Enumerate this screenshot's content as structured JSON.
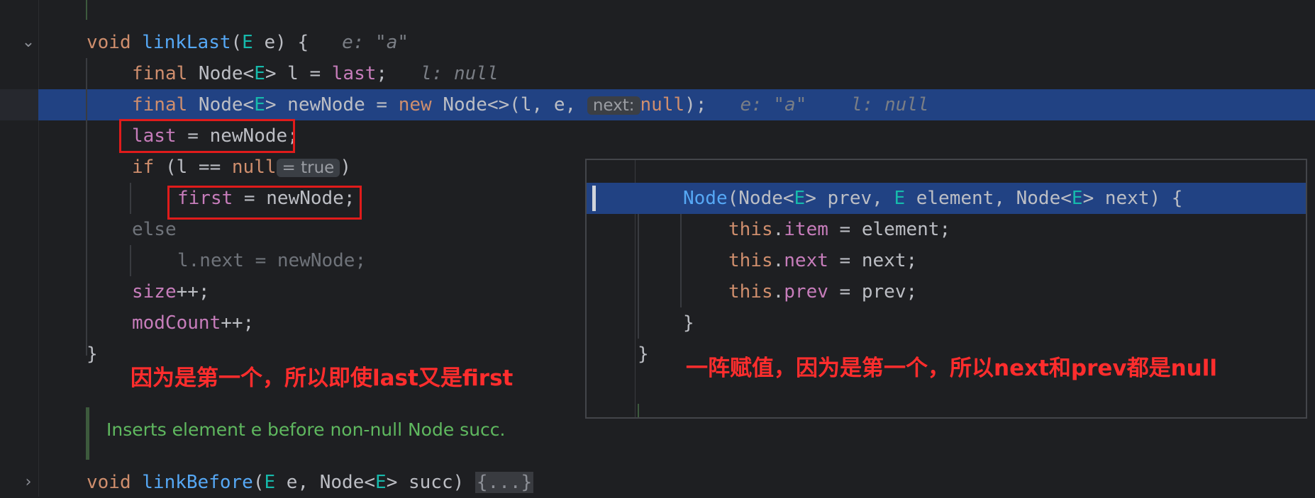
{
  "editor": {
    "line_0_partial": "",
    "link_last": {
      "kw_void": "void",
      "name": "linkLast",
      "open": "(",
      "type_E": "E",
      "param": " e) {",
      "hint": "e: \"a\""
    },
    "line_l": {
      "kw_final": "final",
      "type": " Node<",
      "type_E": "E",
      "rest1": "> l = ",
      "field_last": "last",
      "semi": ";",
      "hint": "l: null"
    },
    "line_newnode": {
      "kw_final": "final",
      "type": " Node<",
      "type_E": "E",
      "rest1": "> newNode = ",
      "kw_new": "new",
      "rest2": " Node<>(l, e, ",
      "inlay_next": "next:",
      "kw_null": "null",
      "rest3": ");",
      "hint_e": "e: \"a\"",
      "hint_l": "l: null"
    },
    "line_last_assign": {
      "field_last": "last",
      "rest": " = newNode;"
    },
    "line_if": {
      "kw_if": "if",
      "rest": " (l == ",
      "kw_null": "null",
      "inlay_true": "= true",
      "close": ")"
    },
    "line_first_assign": {
      "field_first": "first",
      "rest": " = newNode;"
    },
    "line_else": "else",
    "line_lnext": "l.next = newNode;",
    "line_size": {
      "field": "size",
      "rest": "++;"
    },
    "line_modcount": {
      "field": "modCount",
      "rest": "++;"
    },
    "close_brace": "}",
    "doc_comment": "Inserts element e before non-null Node succ.",
    "link_before": {
      "kw_void": "void",
      "name": "linkBefore",
      "open": "(",
      "type_E": "E",
      "rest1": " e, Node<",
      "type_E2": "E",
      "rest2": "> succ) ",
      "folded": "{...}"
    }
  },
  "popup": {
    "ctor": {
      "name": "Node",
      "p1": "(Node<",
      "E1": "E",
      "p2": "> prev, ",
      "E2": "E",
      "p3": " element, Node<",
      "E3": "E",
      "p4": "> next) {"
    },
    "item": {
      "kw_this": "this",
      "dot": ".",
      "field": "item",
      "rest": " = element;"
    },
    "next": {
      "kw_this": "this",
      "dot": ".",
      "field": "next",
      "rest": " = next;"
    },
    "prev": {
      "kw_this": "this",
      "dot": ".",
      "field": "prev",
      "rest": " = prev;"
    },
    "inner_close": "}",
    "outer_close": "}"
  },
  "annotations": {
    "left": "因为是第一个，所以即使last又是first",
    "right": "一阵赋值，因为是第一个，所以next和prev都是null"
  },
  "icons": [
    "chevron-down-icon",
    "chevron-right-icon"
  ],
  "colors": {
    "background": "#1e1f22",
    "highlight": "#214283",
    "keyword": "#cf8e6d",
    "function": "#56a8f5",
    "type_param": "#16baac",
    "field": "#c77dbb",
    "annotation_red": "#ff2d2d",
    "doc_green": "#5fb85f"
  }
}
